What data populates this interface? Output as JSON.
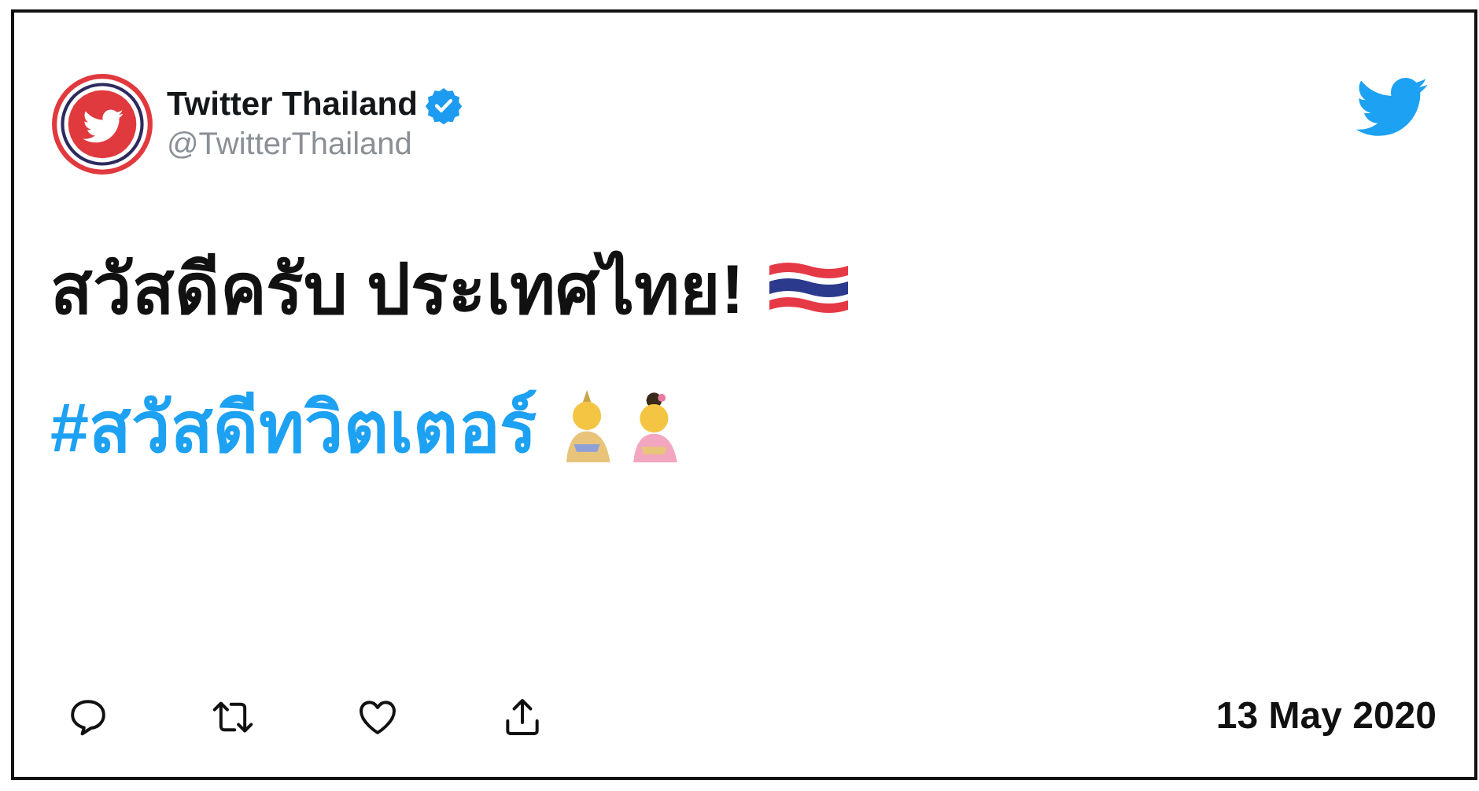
{
  "author": {
    "name": "Twitter Thailand",
    "handle": "@TwitterThailand",
    "verified": true
  },
  "text": "สวัสดีครับ ประเทศไทย!",
  "hashtag": "#สวัสดีทวิตเตอร์",
  "date": "13 May 2020"
}
